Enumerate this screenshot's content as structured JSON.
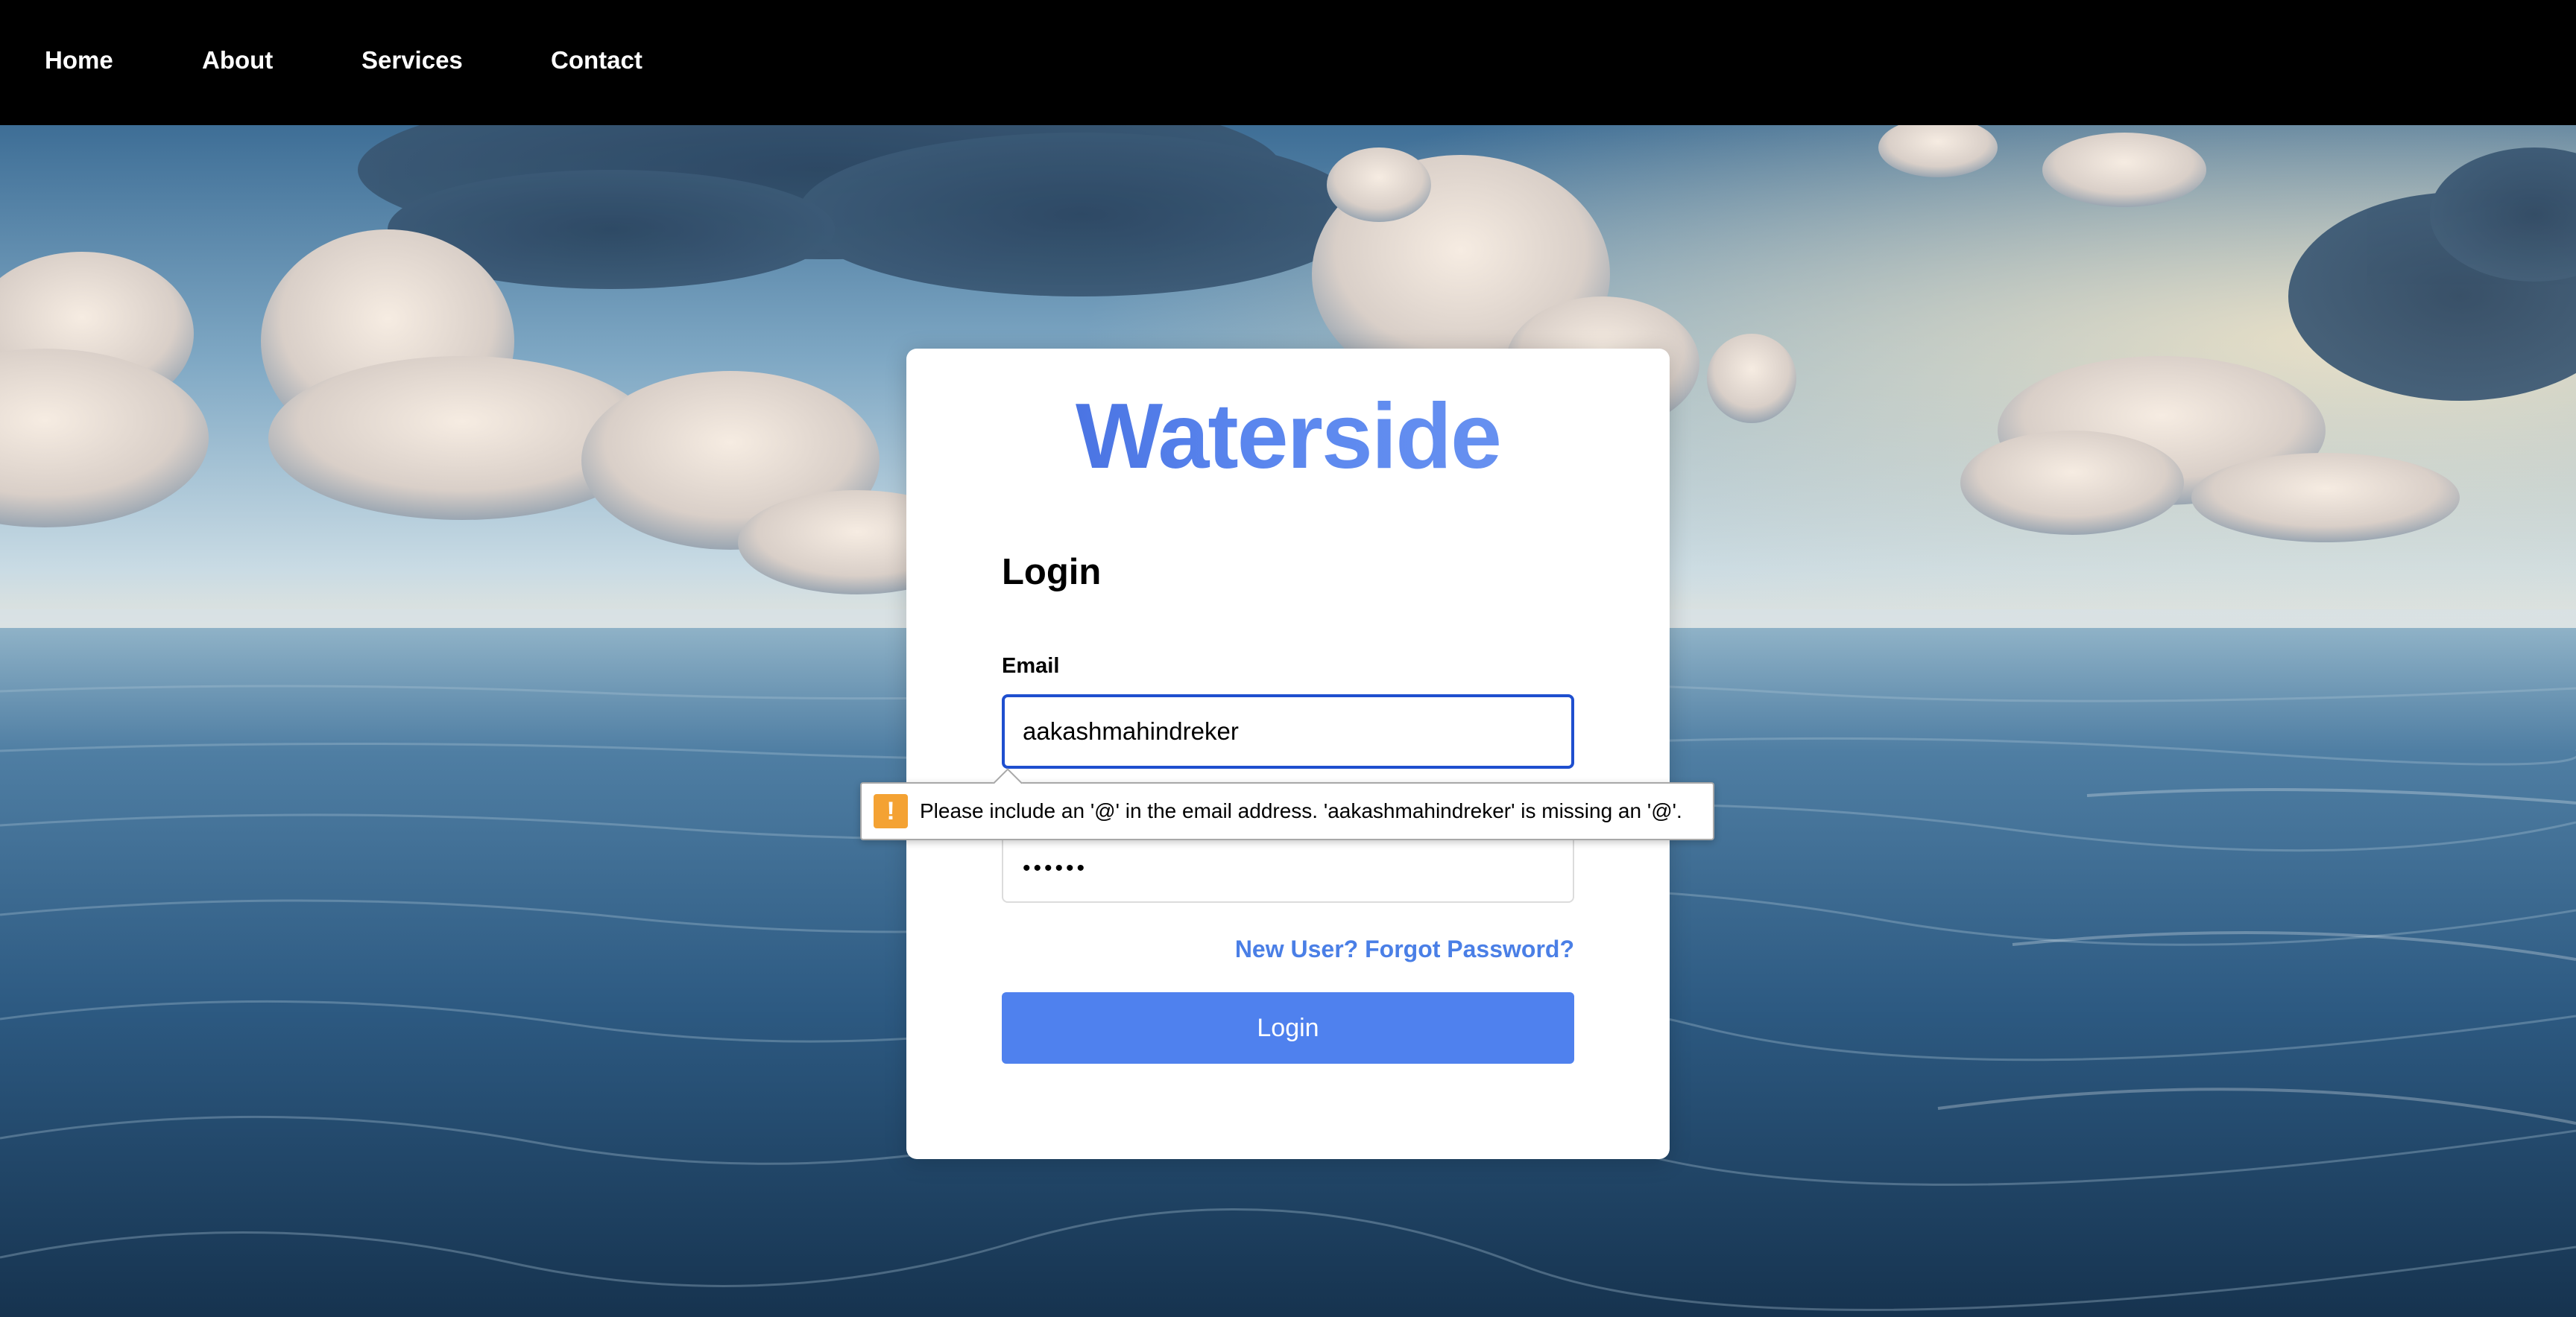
{
  "nav": {
    "items": [
      {
        "label": "Home"
      },
      {
        "label": "About"
      },
      {
        "label": "Services"
      },
      {
        "label": "Contact"
      }
    ]
  },
  "brand": {
    "name": "Waterside",
    "colors": [
      "#3c63d8",
      "#6f98f2"
    ]
  },
  "login_form": {
    "heading": "Login",
    "email_label": "Email",
    "email_value": "aakashmahindreker",
    "password_value": "••••••",
    "link_text": "New User? Forgot Password?",
    "submit_label": "Login",
    "accent_color": "#4f81ee"
  },
  "validation": {
    "icon": "warning-icon",
    "message": "Please include an '@' in the email address. 'aakashmahindreker' is missing an '@'.",
    "icon_color": "#f4a233"
  }
}
